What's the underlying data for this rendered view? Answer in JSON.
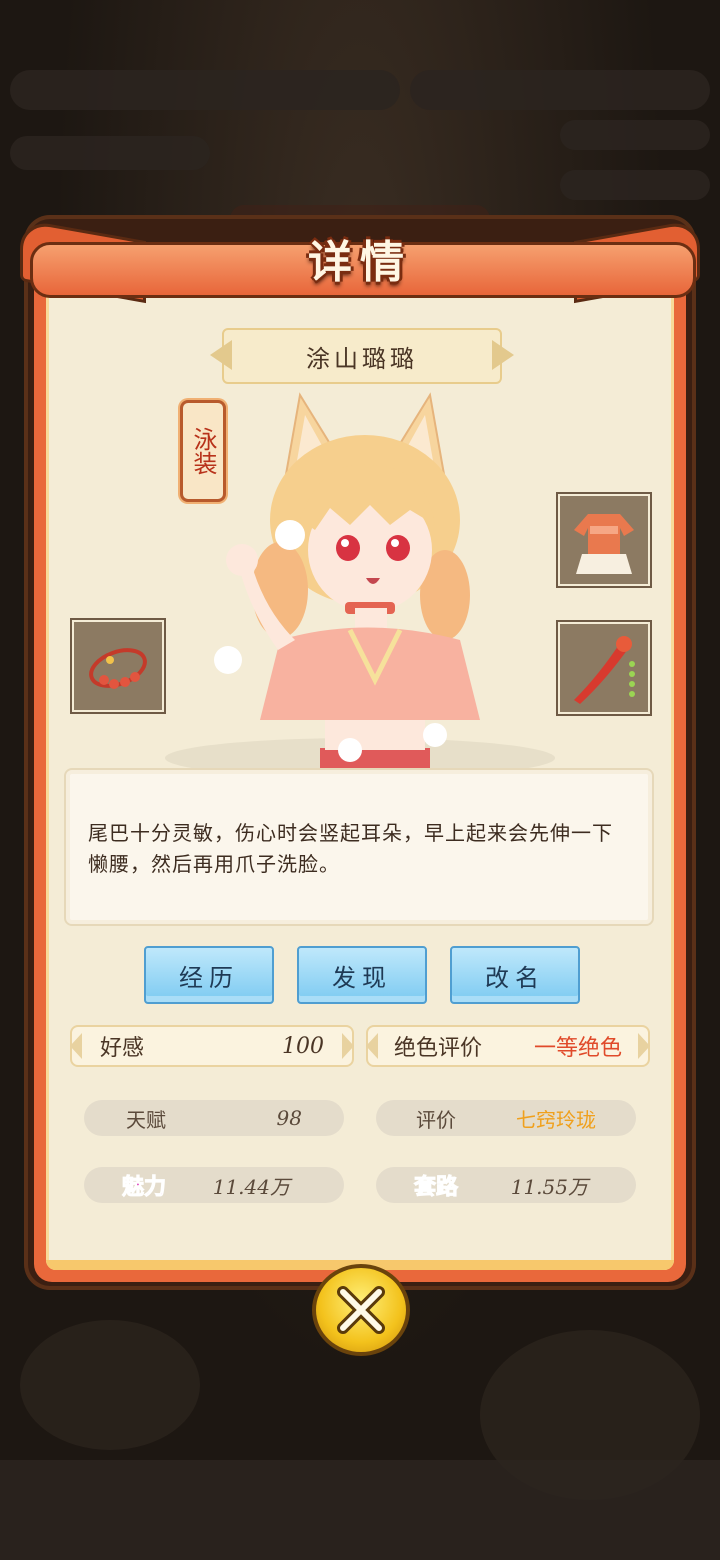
{
  "header": {
    "title": "详情"
  },
  "character": {
    "name": "涂山璐璐",
    "outfit_tag": "泳装"
  },
  "description": "尾巴十分灵敏，伤心时会竖起耳朵，早上起来会先伸一下懒腰，然后再用爪子洗脸。",
  "buttons": {
    "history": "经历",
    "discover": "发现",
    "rename": "改名"
  },
  "stats": {
    "favor_label": "好感",
    "favor_value": "100",
    "beauty_label": "绝色评价",
    "beauty_value": "一等绝色",
    "talent_label": "天赋",
    "talent_value": "98",
    "rating_label": "评价",
    "rating_value": "七窍玲珑",
    "charm_label": "魅力",
    "charm_value": "11.44万",
    "trick_label": "套路",
    "trick_value": "11.55万"
  },
  "colors": {
    "accent": "#e9683b",
    "frame": "#3b1f12",
    "button": "#7ccaf1",
    "rating": "#f0a01c",
    "grade": "#e04a2a"
  },
  "icons": {
    "close": "close-x-icon",
    "bracelet": "bracelet-icon",
    "dress": "dress-icon",
    "hairpin": "hairpin-icon"
  }
}
